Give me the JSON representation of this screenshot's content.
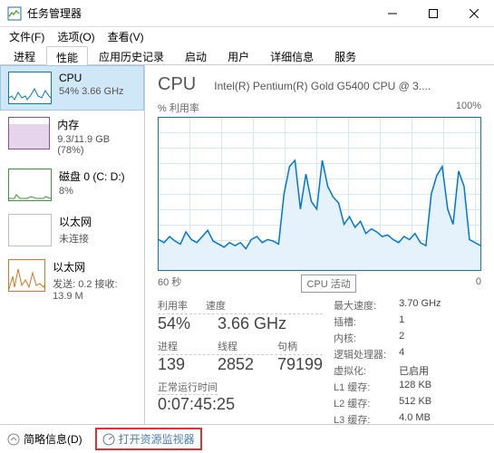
{
  "window": {
    "title": "任务管理器"
  },
  "menu": {
    "file": "文件(F)",
    "options": "选项(O)",
    "view": "查看(V)"
  },
  "tabs": {
    "processes": "进程",
    "performance": "性能",
    "history": "应用历史记录",
    "startup": "启动",
    "users": "用户",
    "details": "详细信息",
    "services": "服务"
  },
  "sidebar": {
    "cpu": {
      "name": "CPU",
      "sub": "54%  3.66 GHz"
    },
    "mem": {
      "name": "内存",
      "sub": "9.3/11.9 GB (78%)"
    },
    "disk": {
      "name": "磁盘 0 (C: D:)",
      "sub": "8%"
    },
    "eth0": {
      "name": "以太网",
      "sub": "未连接"
    },
    "eth1": {
      "name": "以太网",
      "sub": "发送: 0.2  接收: 13.9 M"
    }
  },
  "main": {
    "title": "CPU",
    "desc": "Intel(R) Pentium(R) Gold G5400 CPU @ 3....",
    "chart_top_left": "% 利用率",
    "chart_top_right": "100%",
    "chart_bottom_left": "60 秒",
    "chart_bottom_right": "0",
    "tooltip": "CPU 活动"
  },
  "stats": {
    "labels": {
      "util": "利用率",
      "speed": "速度",
      "proc": "进程",
      "threads": "线程",
      "handles": "句柄",
      "uptime": "正常运行时间"
    },
    "util": "54%",
    "speed": "3.66 GHz",
    "proc": "139",
    "threads": "2852",
    "handles": "79199",
    "uptime": "0:07:45:25"
  },
  "info": {
    "max_speed_k": "最大速度:",
    "max_speed_v": "3.70 GHz",
    "sockets_k": "插槽:",
    "sockets_v": "1",
    "cores_k": "内核:",
    "cores_v": "2",
    "logical_k": "逻辑处理器:",
    "logical_v": "4",
    "virt_k": "虚拟化:",
    "virt_v": "已启用",
    "l1_k": "L1 缓存:",
    "l1_v": "128 KB",
    "l2_k": "L2 缓存:",
    "l2_v": "512 KB",
    "l3_k": "L3 缓存:",
    "l3_v": "4.0 MB"
  },
  "footer": {
    "brief": "简略信息(D)",
    "resmon": "打开资源监视器"
  },
  "chart_data": {
    "type": "line",
    "title": "CPU 活动",
    "xlabel": "60 秒",
    "ylabel": "% 利用率",
    "ylim": [
      0,
      100
    ],
    "values": [
      20,
      18,
      22,
      19,
      17,
      25,
      20,
      18,
      22,
      26,
      19,
      17,
      15,
      18,
      16,
      18,
      14,
      20,
      22,
      18,
      20,
      19,
      17,
      50,
      68,
      72,
      40,
      63,
      45,
      40,
      72,
      55,
      48,
      44,
      30,
      35,
      28,
      32,
      24,
      27,
      25,
      22,
      23,
      20,
      18,
      22,
      20,
      24,
      18,
      16,
      50,
      62,
      68,
      40,
      30,
      65,
      55,
      20,
      18,
      16
    ]
  }
}
